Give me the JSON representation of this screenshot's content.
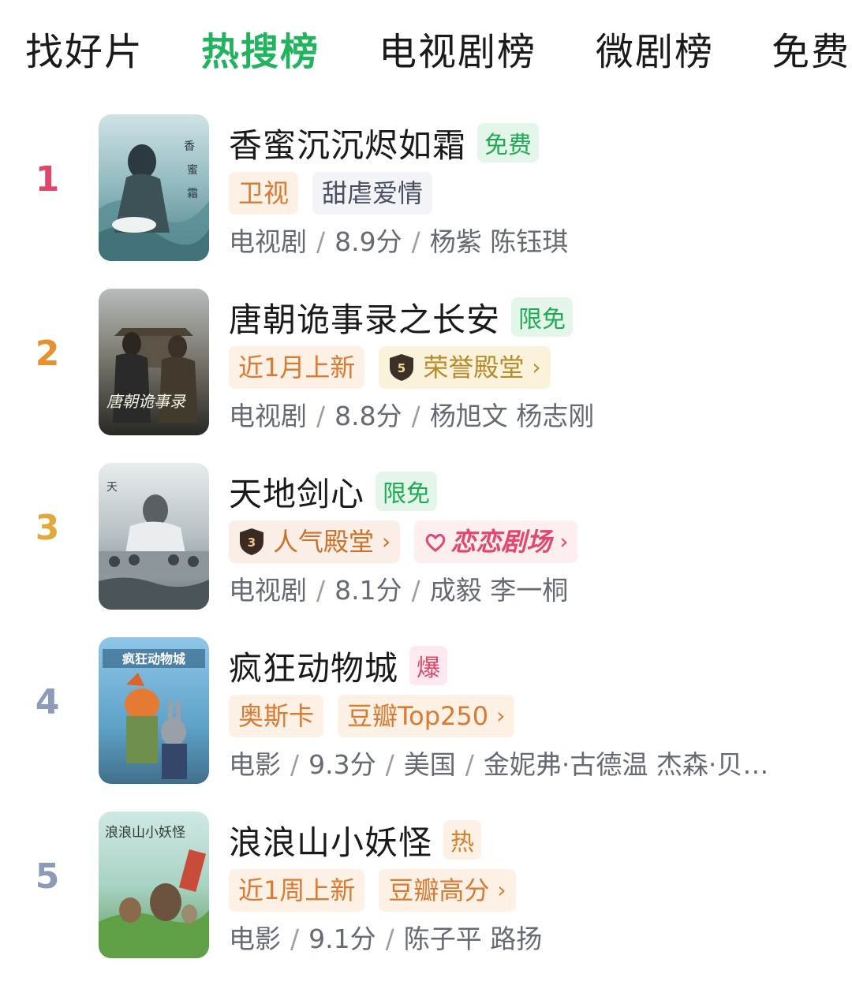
{
  "tabs": [
    {
      "label": "找好片",
      "active": false
    },
    {
      "label": "热搜榜",
      "active": true
    },
    {
      "label": "电视剧榜",
      "active": false
    },
    {
      "label": "微剧榜",
      "active": false
    },
    {
      "label": "免费",
      "active": false
    }
  ],
  "colors": {
    "accent": "#22b35e",
    "rank_1": "#e0466a",
    "rank_2": "#e8912f",
    "rank_3": "#e0a93a",
    "rank_4": "#8c9bb8",
    "rank_5": "#8c9bb8"
  },
  "items": [
    {
      "rank": "1",
      "title": "香蜜沉沉烬如霜",
      "badge": "免费",
      "tags": [
        "卫视",
        "甜虐爱情"
      ],
      "type": "电视剧",
      "score": "8.9分",
      "extra": "",
      "people": "杨紫 陈钰琪"
    },
    {
      "rank": "2",
      "title": "唐朝诡事录之长安",
      "badge": "限免",
      "tags": [
        "近1月上新",
        "荣誉殿堂"
      ],
      "shield_level": "5",
      "type": "电视剧",
      "score": "8.8分",
      "extra": "",
      "people": "杨旭文 杨志刚"
    },
    {
      "rank": "3",
      "title": "天地剑心",
      "badge": "限免",
      "tags": [
        "人气殿堂",
        "恋恋剧场"
      ],
      "shield_level": "3",
      "type": "电视剧",
      "score": "8.1分",
      "extra": "",
      "people": "成毅 李一桐"
    },
    {
      "rank": "4",
      "title": "疯狂动物城",
      "badge": "爆",
      "tags": [
        "奥斯卡",
        "豆瓣Top250"
      ],
      "type": "电影",
      "score": "9.3分",
      "extra": "美国",
      "people": "金妮弗·古德温 杰森·贝…"
    },
    {
      "rank": "5",
      "title": "浪浪山小妖怪",
      "badge": "热",
      "tags": [
        "近1周上新",
        "豆瓣高分"
      ],
      "type": "电影",
      "score": "9.1分",
      "extra": "",
      "people": "陈子平 路扬"
    }
  ],
  "chevron": "›"
}
